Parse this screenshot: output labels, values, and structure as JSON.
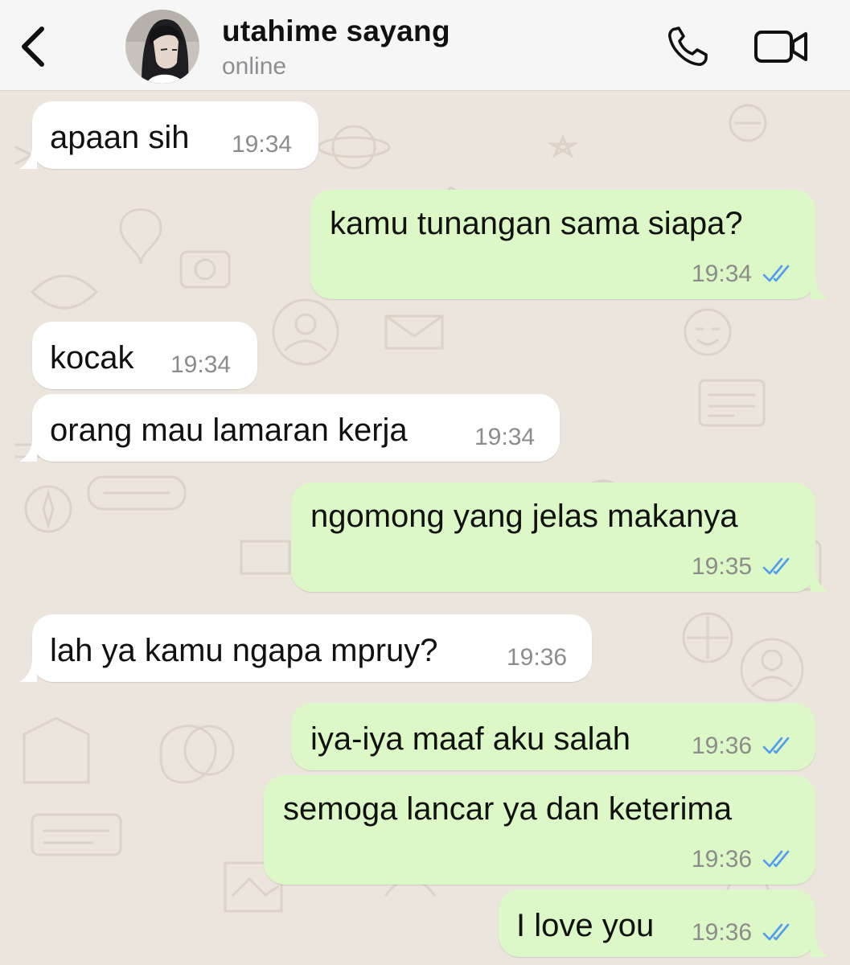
{
  "header": {
    "contact_name": "utahime sayang",
    "status": "online",
    "icons": [
      "back-chevron-icon",
      "phone-icon",
      "video-camera-icon"
    ]
  },
  "colors": {
    "header_bg": "#f6f6f6",
    "chat_bg": "#ece5dd",
    "incoming_bubble": "#ffffff",
    "outgoing_bubble": "#dcf8c6",
    "read_ticks": "#4f9cf0"
  },
  "messages": [
    {
      "direction": "in",
      "text": "apaan sih",
      "time": "19:34"
    },
    {
      "direction": "out",
      "text": "kamu tunangan sama siapa?",
      "time": "19:34",
      "status": "read"
    },
    {
      "direction": "in",
      "text": "kocak",
      "time": "19:34"
    },
    {
      "direction": "in",
      "text": "orang mau lamaran kerja",
      "time": "19:34"
    },
    {
      "direction": "out",
      "text": "ngomong yang jelas makanya",
      "time": "19:35",
      "status": "read"
    },
    {
      "direction": "in",
      "text": "lah ya kamu ngapa mpruy?",
      "time": "19:36"
    },
    {
      "direction": "out",
      "text": "iya-iya maaf aku salah",
      "time": "19:36",
      "status": "read"
    },
    {
      "direction": "out",
      "text": "semoga lancar ya dan keterima",
      "time": "19:36",
      "status": "read"
    },
    {
      "direction": "out",
      "text": "I love you",
      "time": "19:36",
      "status": "read"
    }
  ]
}
